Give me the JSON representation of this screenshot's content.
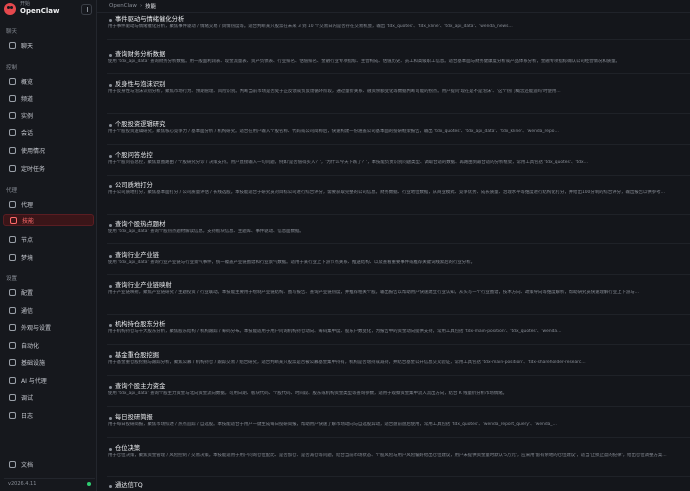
{
  "brand": {
    "small": "开始",
    "name": "OpenClaw"
  },
  "breadcrumb": {
    "root": "OpenClaw",
    "sep": "›",
    "current": "技能"
  },
  "sidebar": {
    "sections": [
      {
        "label": "聊天",
        "items": [
          {
            "label": "聊天"
          }
        ]
      },
      {
        "label": "控制",
        "items": [
          {
            "label": "概览"
          },
          {
            "label": "频道"
          },
          {
            "label": "实例"
          },
          {
            "label": "会话"
          },
          {
            "label": "使用情况"
          },
          {
            "label": "定时任务"
          }
        ]
      },
      {
        "label": "代理",
        "items": [
          {
            "label": "代理"
          },
          {
            "label": "技能"
          },
          {
            "label": "节点"
          },
          {
            "label": "梦境"
          }
        ]
      },
      {
        "label": "设置",
        "items": [
          {
            "label": "配置"
          },
          {
            "label": "通信"
          },
          {
            "label": "外观与设置"
          },
          {
            "label": "自动化"
          },
          {
            "label": "基础设施"
          },
          {
            "label": "AI 与代理"
          },
          {
            "label": "调试"
          },
          {
            "label": "日志"
          }
        ]
      }
    ],
    "footer_docs": "文档",
    "version": "v2026.4.11"
  },
  "skills": [
    {
      "title": "事件驱动与情绪催化分析",
      "desc": "用于事件驱动与情绪催化分析，聚焦事件驱动 / 情绪交易 / 舆情热度等。适合判断某只股票在未来 3 到 10 个交易日内是否存在交易机会，输出 'tdx_quotes'、'tdx_kline'、'tdx_api_data'、'wenda_news…"
    },
    {
      "title": "查询财务分析数据",
      "desc": "使用 'tdx_api_data' 查询财务分析数据。用一般面利润表、现金流量表、资产负债表、行业排名、估值排名、金融行业专项指标、主营构成、估值历史、员工和高级职工信息。适合基本面与财务健康度分析或产品体系分析，金融专项指标确认公司经营情况和质量。"
    },
    {
      "title": "反身性与泡沫识别",
      "desc": "用于反身性与泡沫识别分析，聚焦市场行为、预期管理、风险识别。判断当前市场是否处于正反馈或负反馈循环阶段，通过量价关系、融资余额变化等数据判断可能的拐点。用户提问'现在是不是泡沫'、'这个热门概念还能追吗'时使用…"
    },
    {
      "title": "个股投资逻辑研究",
      "desc": "用于个股投资逻辑研究，聚焦核心竞争力 / 基本面分析 / 机构研究。适合在用户输入个股名称、代码或公司简称后，快速构建一份涵盖公司基本面的投研框架报告，输出 'tdx_quotes'、'tdx_api_data'、'tdx_kline'、'wenda_repo…"
    },
    {
      "title": "个股问答总控",
      "desc": "用于个股问答总控，聚焦意图路由 / 个股研究分诊 / 决策支持。用户直接输入一句问题，例如'是否值得买入？'，'为什么今天下跌了？'，本技能负责识别问题类型、调取合适的数据、再路由到最合适的分析框架，常用工具包括 'tdx_quotes'、'tdx…"
    },
    {
      "title": "公司质地打分",
      "desc": "用于公司质地打分，聚焦基本面打分 / 公司质量评估 / 长线选股。本技能适合于研究员对目标公司进行综合评分，需要获取完整的公司信息，财务数据、行业地位数据，从商业模式、竞争优势、成长质量、治理水平等维度进行结构化打分，并给出100分制的综合评分，输出报告以供参考…"
    },
    {
      "title": "查询个股热点题材",
      "desc": "使用 'tdx_api_data' 查询个股热点题材解读信息，支持板块信息、主题库、事件驱动、信息面数据。"
    },
    {
      "title": "查询行业产业链",
      "desc": "使用 'tdx_api_data' 查询行业产业链与行业景气事件，统一覆盖产业链图谱和行业景气数据。适用于某行业上下游节点关系、推送结构、以及查看重要事件或推荐关键词线索后的行业分析。"
    },
    {
      "title": "查询行业产业链映射",
      "desc": "用于产业链映射，聚焦产业链研究 / 主题投资 / 行业联动。本技能主要用于绘制产业链结构、图写报告、查询产业链热度，并推荐相关个股。输出报告以帮助用户快速建立行业认知，从头写一个行业图谱，技术方向、政策导向等维度解析，帮助研究员快速理解行业上下游与…"
    },
    {
      "title": "机构持仓股东分析",
      "desc": "用于机构持仓与十大股东分析，聚焦股东结构 / 机构跟踪 / 筹码分布。本技能适用于用户问询机构持仓动向、筹码集中度、股东户数变化，为报告中的资金动向提供支持，常用工具包括 'tdx-main-position'、'tdx_quotes'、'wenda…"
    },
    {
      "title": "基金重仓股挖掘",
      "desc": "用于基金重仓股挖掘与跟踪分析，聚焦公募 / 机构持仓 / 跟踪交易 / 组合研究，适合判断某只股票是否被公募基金集中持有，机构是否增持或减持，并结合基金公开信息交叉验证，常用工具包括 'tdx-main-position'、'tdx-shareholder-researc…"
    },
    {
      "title": "查询个股主力资金",
      "desc": "使用 'tdx_api_data' 查询个股主力资金与北向资金流向数据，可用日期、板块代码、个股代码、时间段、股东或机构资金类型等查询参数，适用于观察资金集中流入流出方向，结合 K 线量价分析市场情绪。"
    },
    {
      "title": "每日投研简报",
      "desc": "用于每日投研简报，聚焦市场综述 / 热点追踪 / 自选股。本技能适合于用户一键生成每日投研简报，帮助用户快速了解市场动向与自选股异动，适合盘前盘后使用，常用工具包括 'tdx_quotes'、'wenda_report_query'、'wenda_…"
    },
    {
      "title": "仓位决策",
      "desc": "用于仓位决策，聚焦资金管理 / 风险控制 / 交易决策。本技能适用于用户问询仓位配比、是否加仓、是否减仓等问题，结合当前市场状态、个股风险与用户风险偏好给出仓位建议，用户未提供资金量时默认'5万元'，应采用'留有余地的仓位建议'，适当'止损止盈的纪律'，给出仓位调整方案…"
    },
    {
      "title": "通达信TQ",
      "desc": ""
    }
  ]
}
